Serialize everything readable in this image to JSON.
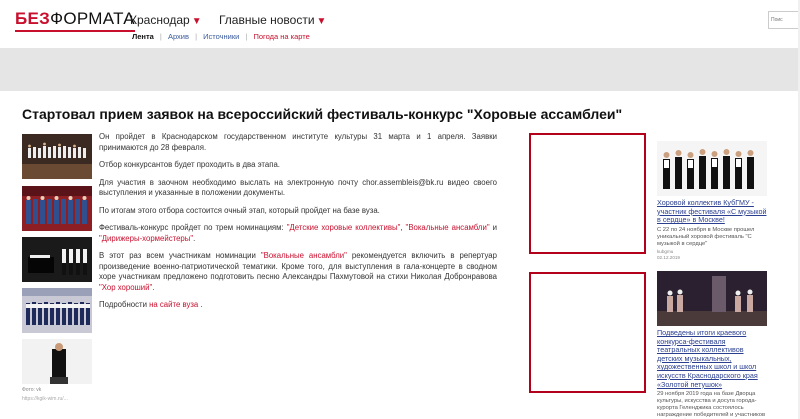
{
  "header": {
    "logo_part1": "БЕЗ",
    "logo_part2": "ФОРМАТА",
    "city": "Краснодар",
    "main_news": "Главные новости",
    "subnav": [
      "Лента",
      "Архив",
      "Источники",
      "Погода на карте"
    ],
    "search_placeholder": "Поис"
  },
  "article": {
    "title": "Стартовал прием заявок на всероссийский фестиваль-конкурс \"Хоровые ассамблеи\"",
    "p1": "Он пройдет в Краснодарском государственном институте культуры 31 марта и 1 апреля. Заявки принимаются до 28 февраля.",
    "p2": "Отбор конкурсантов будет проходить в два этапа.",
    "p3": "Для участия в заочном необходимо выслать на электронную почту chor.assembleis@bk.ru видео своего выступления и указанные в положении документы.",
    "p4": "По итогам этого отбора состоится очный этап, который пройдет на базе вуза.",
    "p5_pre": "Фестиваль-конкурс пройдет по трем номинациям: ",
    "nom1": "\"Детские хоровые коллективы\"",
    "p5_mid1": ", ",
    "nom2": "\"Вокальные ансамбли\"",
    "p5_mid2": " и ",
    "nom3": "\"Дирижеры-хормейстеры\"",
    "p5_end": ".",
    "p6_pre": "В этот раз всем участникам номинации ",
    "nom_vocal": "\"Вокальные ансамбли\"",
    "p6_mid": " рекомендуется включить в репертуар произведение военно-патриотической тематики. Кроме того, для выступления в гала-концерте в сводном хоре участникам предложено подготовить песню Александры Пахмутовой на стихи Николая Добронравова ",
    "song": "\"Хор хороший\"",
    "p6_end": ".",
    "p7_pre": "Подробности ",
    "p7_link": "на сайте вуза",
    "p7_end": " .",
    "photo_caption": "Фото: vk",
    "photo_caption2": "https://kgik-wim.ru/..."
  },
  "sidebar": {
    "news": [
      {
        "headline": "Хоровой коллектив КубГМУ - участник фестиваля «С музыкой в сердце» в Москве!",
        "snippet": "С 22 по 24 ноября в Москве прошел уникальный хоровой фестиваль \"С музыкой в сердце\"",
        "source": "kubgmu",
        "date": "02.12.2019"
      },
      {
        "headline": "Подведены итоги краевого конкурса-фестиваля театральных коллективов детских музыкальных, художественных школ и школ искусств Краснодарского края «Золотой петушок»",
        "snippet": "29 ноября 2019 года на базе Дворца культуры, искусства и досуга города-курорта Геленджика состоялось награждение победителей и участников конкурса-фестиваля."
      }
    ]
  }
}
